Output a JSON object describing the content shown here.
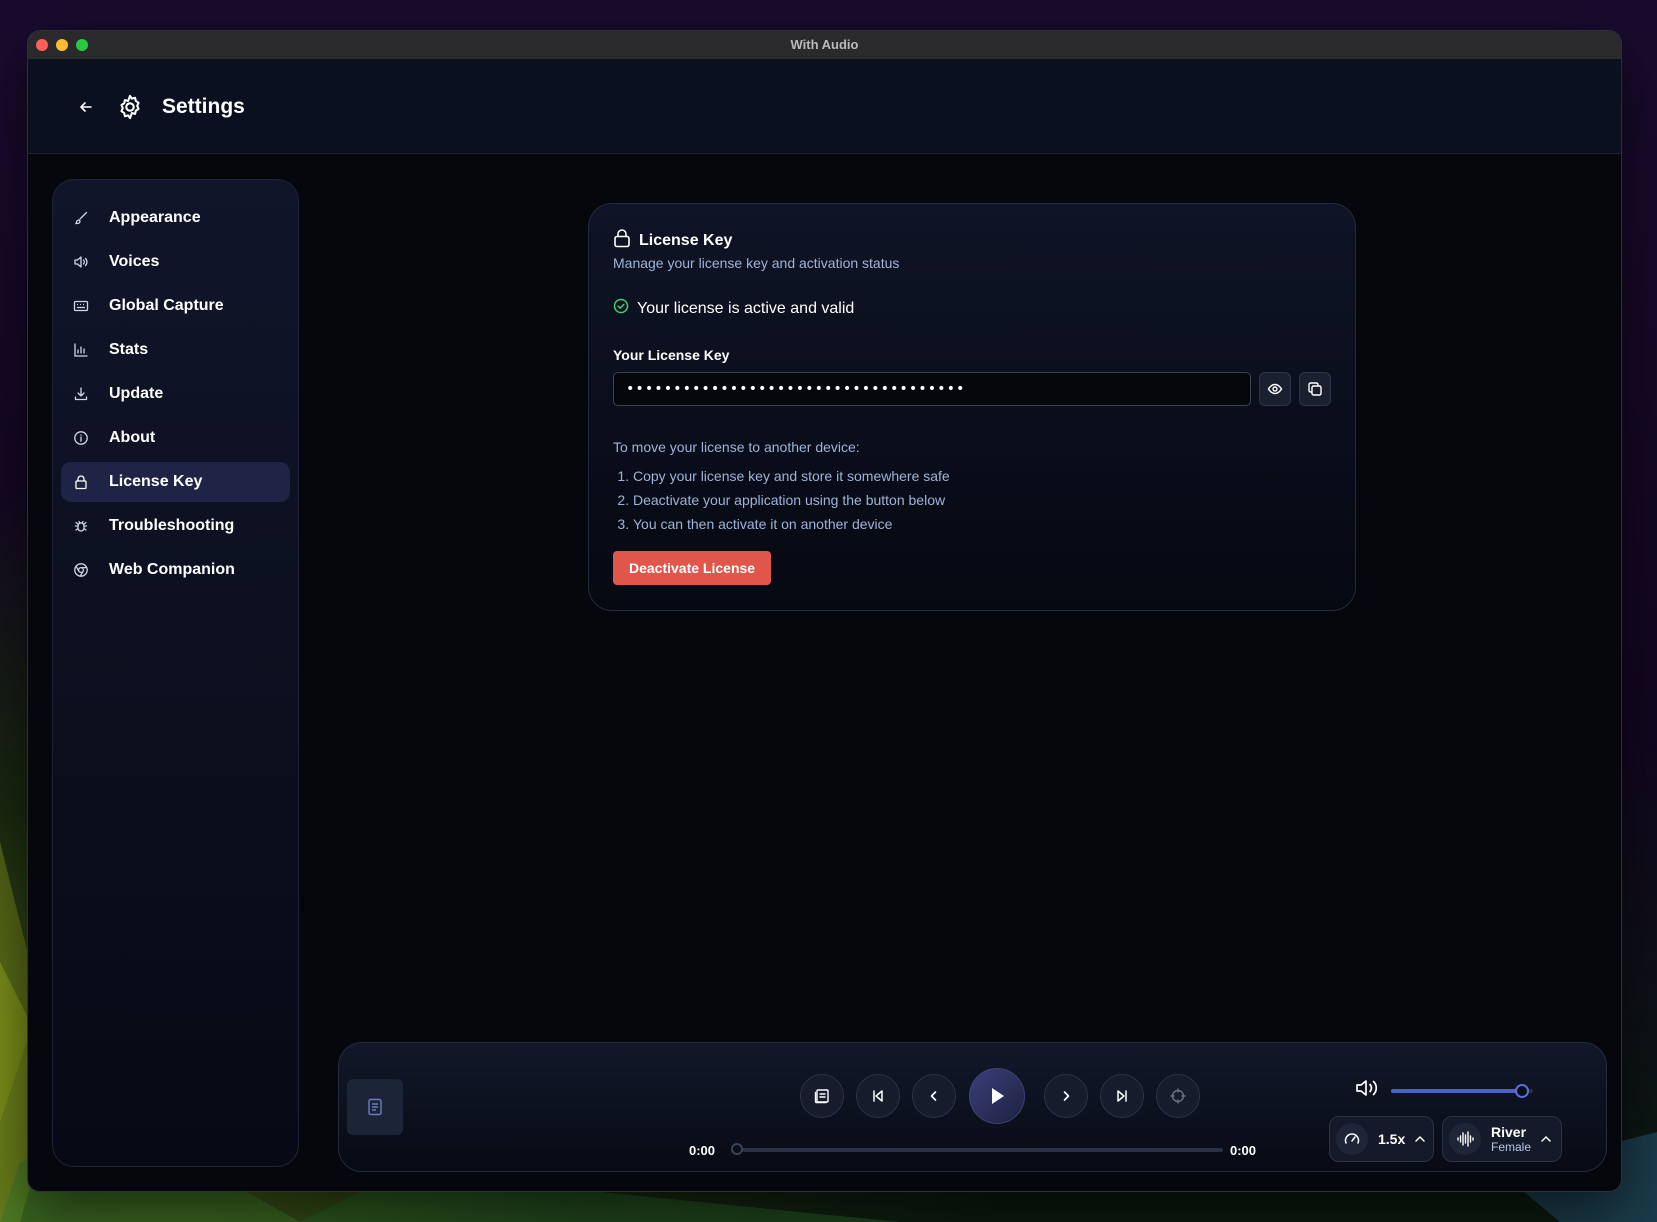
{
  "window": {
    "title": "With Audio"
  },
  "header": {
    "title": "Settings"
  },
  "sidebar": {
    "items": [
      {
        "label": "Appearance",
        "icon": "brush-icon"
      },
      {
        "label": "Voices",
        "icon": "speaker-icon"
      },
      {
        "label": "Global Capture",
        "icon": "keyboard-icon"
      },
      {
        "label": "Stats",
        "icon": "chart-icon"
      },
      {
        "label": "Update",
        "icon": "download-icon"
      },
      {
        "label": "About",
        "icon": "info-icon"
      },
      {
        "label": "License Key",
        "icon": "lock-icon",
        "active": true
      },
      {
        "label": "Troubleshooting",
        "icon": "bug-icon"
      },
      {
        "label": "Web Companion",
        "icon": "chrome-icon"
      }
    ]
  },
  "license": {
    "title": "License Key",
    "subtitle": "Manage your license key and activation status",
    "status": "Your license is active and valid",
    "field_label": "Your License Key",
    "key_masked": "••••••••••••••••••••••••••••••••••••",
    "move_heading": "To move your license to another device:",
    "steps": [
      "Copy your license key and store it somewhere safe",
      "Deactivate your application using the button below",
      "You can then activate it on another device"
    ],
    "deactivate_label": "Deactivate License"
  },
  "player": {
    "time_current": "0:00",
    "time_total": "0:00",
    "progress": 0,
    "volume": 0.92,
    "speed": "1.5x",
    "voice_name": "River",
    "voice_gender": "Female"
  },
  "colors": {
    "accent": "#4a61c9",
    "danger": "#e0564a",
    "success": "#3ecf6e",
    "active_nav": "#1f2447"
  }
}
